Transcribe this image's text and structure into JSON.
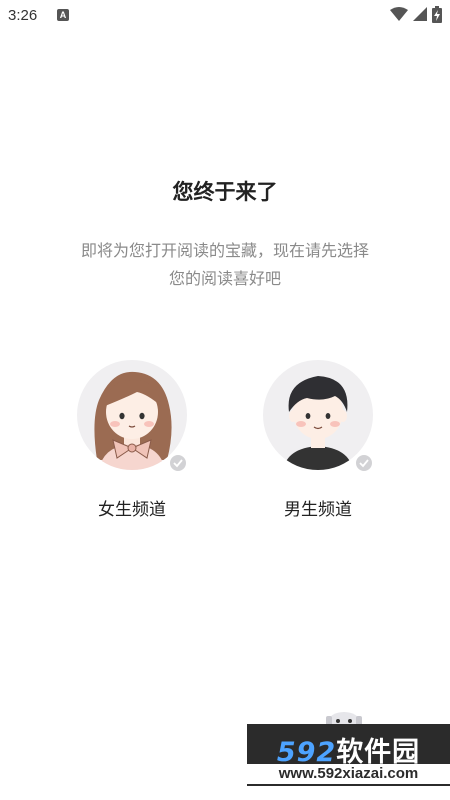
{
  "status_bar": {
    "time": "3:26",
    "notification_letter": "A"
  },
  "title": "您终于来了",
  "subtitle": "即将为您打开阅读的宝藏，现在请先选择您的阅读喜好吧",
  "channels": [
    {
      "label": "女生频道",
      "selected": false
    },
    {
      "label": "男生频道",
      "selected": false
    }
  ],
  "watermark": {
    "number": "592",
    "name": "软件园",
    "url": "www.592xiazai.com"
  },
  "colors": {
    "background": "#ffffff",
    "subtitle": "#8a8a8a",
    "avatar_bg": "#f0eff1",
    "check_badge": "#d2d2d5"
  }
}
